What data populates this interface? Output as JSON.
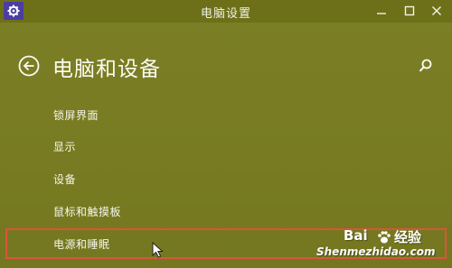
{
  "window": {
    "title": "电脑设置"
  },
  "header": {
    "title": "电脑和设备"
  },
  "nav": {
    "items": [
      {
        "label": "锁屏界面"
      },
      {
        "label": "显示"
      },
      {
        "label": "设备"
      },
      {
        "label": "鼠标和触摸板"
      },
      {
        "label": "电源和睡眠",
        "highlighted": true
      }
    ]
  },
  "watermark": {
    "brand_left": "Bai",
    "brand_right": "经验",
    "url": "Shenmezhidao.com"
  },
  "icons": {
    "app": "gear-icon",
    "back": "back-arrow-icon",
    "search": "search-icon",
    "minimize": "minimize-icon",
    "maximize": "maximize-icon",
    "close": "close-icon",
    "cursor": "mouse-cursor-icon"
  },
  "colors": {
    "background": "#7a7d23",
    "titlebar": "#6d7019",
    "app_icon_bg": "#4b3ea3",
    "text": "#f6f6ea",
    "highlight_border": "#d9553a"
  }
}
